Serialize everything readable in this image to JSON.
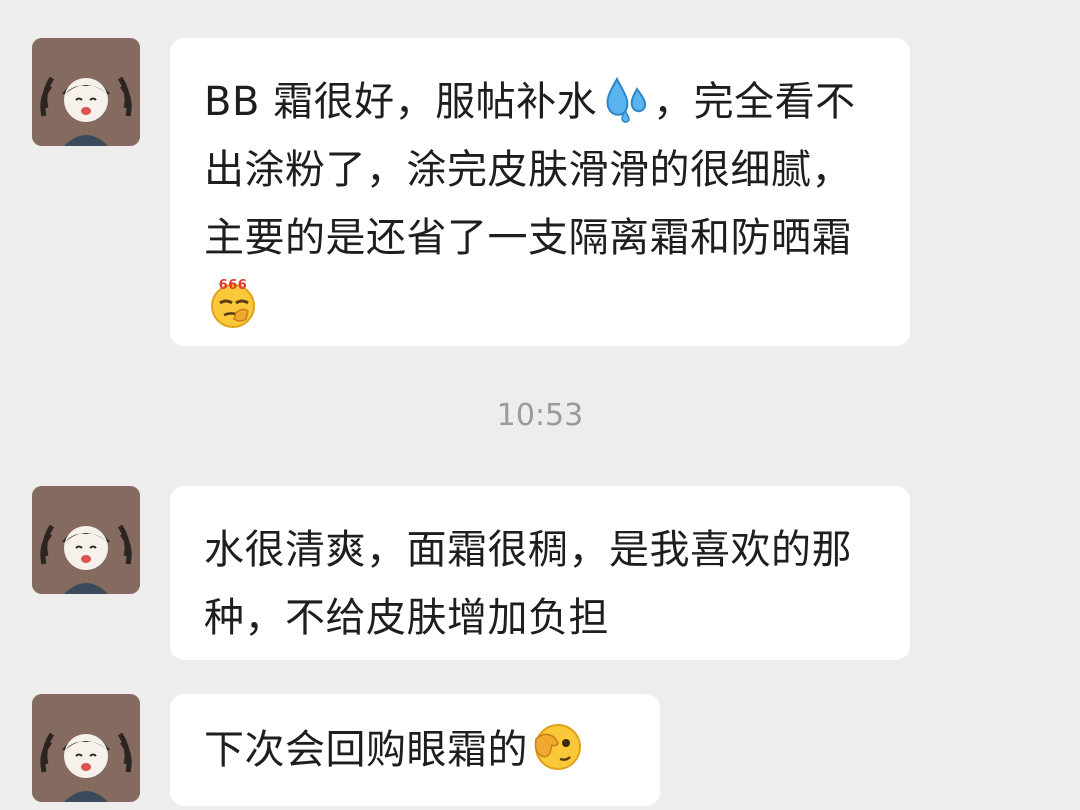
{
  "messages": [
    {
      "segments": [
        "BB 霜很好，服帖补水",
        "，完全看不出涂粉了，涂完皮肤滑滑的很细腻，主要的是还省了一支隔离霜和防晒霜"
      ],
      "emojis": [
        "sweat-droplets-emoji",
        "666-emoji"
      ]
    },
    {
      "segments": [
        "水很清爽，面霜很稠，是我喜欢的那种，不给皮肤增加负担"
      ],
      "emojis": []
    },
    {
      "segments": [
        "下次会回购眼霜的"
      ],
      "emojis": [
        "facepalm-peek-emoji"
      ]
    }
  ],
  "timestamp": "10:53",
  "emoji_labels": {
    "666": "666"
  },
  "colors": {
    "background": "#ededed",
    "bubble": "#ffffff",
    "text": "#1e1e1e",
    "timestamp": "#9a9a9a",
    "avatar_bg": "#846a5f"
  }
}
